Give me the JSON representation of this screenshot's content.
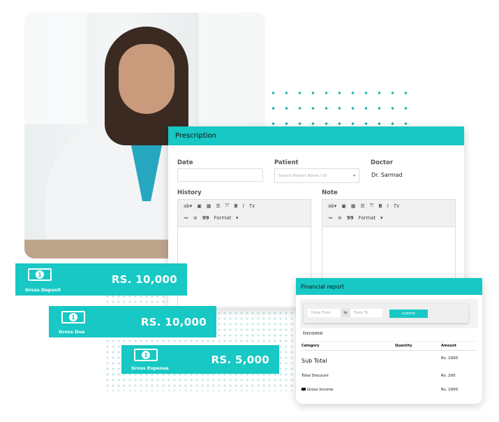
{
  "prescription": {
    "title": "Prescription",
    "date_label": "Date",
    "date_value": "",
    "patient_label": "Patient",
    "patient_placeholder": "Search Patient Name / ID",
    "doctor_label": "Doctor",
    "doctor_value": "Dr. Sarmad",
    "history_label": "History",
    "note_label": "Note",
    "toolbar": {
      "bold": "B",
      "italic": "I",
      "clear": "Tx",
      "quote": "99",
      "format": "Format"
    }
  },
  "banners": [
    {
      "caption": "Gross Deposit",
      "amount": "RS. 10,000",
      "icon": "banknote-icon"
    },
    {
      "caption": "Gross Due",
      "amount": "RS. 10,000",
      "icon": "banknote-icon"
    },
    {
      "caption": "Gross Expense",
      "amount": "RS. 5,000",
      "icon": "banknote-icon"
    }
  ],
  "financial_report": {
    "title": "Financial report",
    "date_from_placeholder": "Date From",
    "to_label": "to",
    "date_to_placeholder": "Date To",
    "submit_label": "submit",
    "section": "Income",
    "columns": [
      "Category",
      "Quantity",
      "Amount"
    ],
    "rows": [
      {
        "category": "Sub Total",
        "amount": "Rs. 1000"
      },
      {
        "category": "Total Discount",
        "amount": "Rs. 200"
      },
      {
        "category": "Gross Income",
        "amount": "Rs. 1000"
      }
    ]
  },
  "colors": {
    "accent": "#17c8c4"
  }
}
